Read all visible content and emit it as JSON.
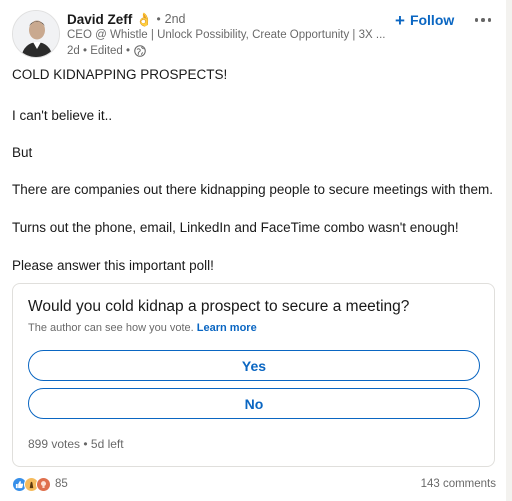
{
  "author": {
    "name": "David Zeff",
    "emoji": "👌",
    "separator": "•",
    "degree": "2nd",
    "headline": "CEO @ Whistle | Unlock Possibility, Create Opportunity | 3X ...",
    "time_edited": "2d • Edited •"
  },
  "actions": {
    "follow_plus": "+",
    "follow_label": "Follow"
  },
  "post": {
    "lines": [
      "COLD KIDNAPPING PROSPECTS!",
      "I can't believe it..",
      "But",
      "There are companies out there kidnapping people to secure meetings with them.",
      "Turns out the phone, email, LinkedIn and FaceTime combo wasn't enough!",
      "Please answer this important poll!"
    ]
  },
  "poll": {
    "question": "Would you cold kidnap a prospect to secure a meeting?",
    "note": "The author can see how you vote.",
    "learn_more": "Learn more",
    "options": [
      "Yes",
      "No"
    ],
    "footer": "899 votes • 5d left"
  },
  "social": {
    "reaction_icons": [
      "like-icon",
      "celebrate-icon",
      "insightful-icon"
    ],
    "reaction_count": "85",
    "comments": "143 comments"
  },
  "colors": {
    "accent": "#0a66c2",
    "text": "#191919",
    "muted": "#666666",
    "border": "#e0dfdc"
  }
}
